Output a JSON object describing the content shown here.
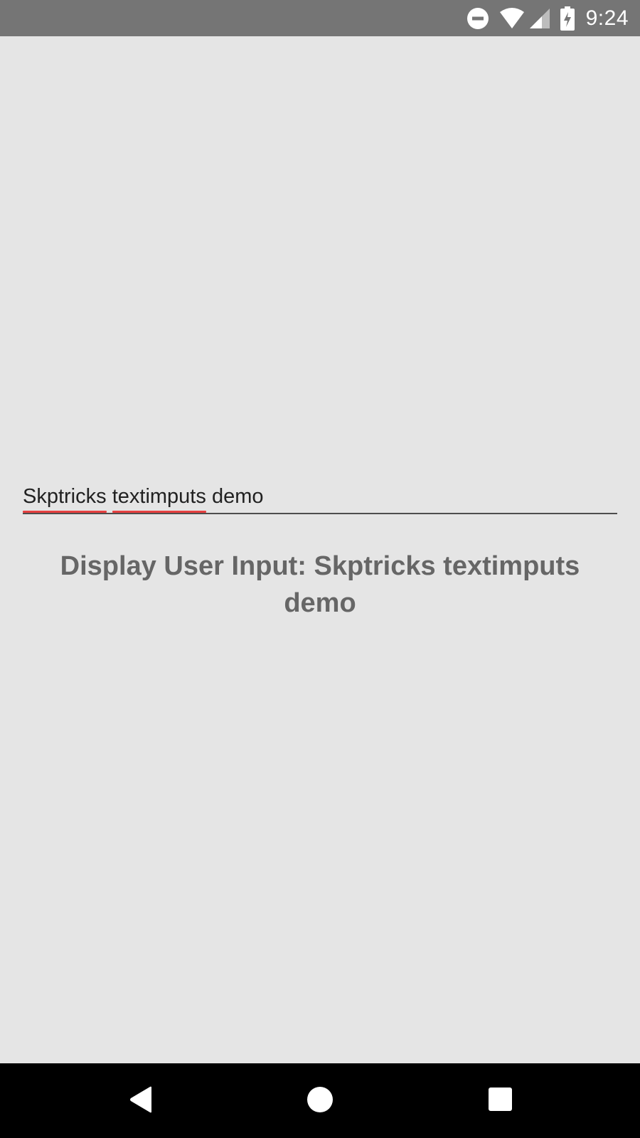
{
  "status_bar": {
    "time": "9:24",
    "icons": [
      "do-not-disturb-icon",
      "wifi-icon",
      "cell-signal-icon",
      "battery-charging-icon"
    ]
  },
  "text_input": {
    "words": [
      "Skptricks",
      "textimputs",
      "demo"
    ],
    "misspelled": [
      "Skptricks",
      "textimputs"
    ]
  },
  "display": {
    "text": "Display User Input: Skptricks textimputs demo"
  },
  "nav_bar": {
    "icons": [
      "back-icon",
      "home-icon",
      "recents-icon"
    ]
  },
  "colors": {
    "status_bar_bg": "#757575",
    "background": "#e5e5e5",
    "display_text": "#666666",
    "spellcheck_underline": "#e64040",
    "nav_bar_bg": "#000000"
  }
}
